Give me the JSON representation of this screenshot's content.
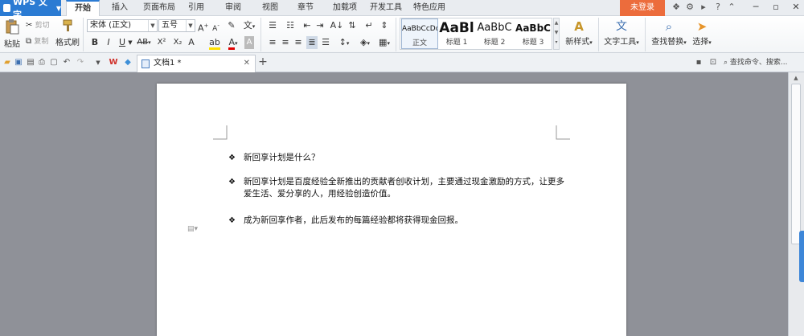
{
  "app": {
    "menu_button": "WPS 文字",
    "login": "未登录"
  },
  "menu": {
    "tabs": [
      "开始",
      "插入",
      "页面布局",
      "引用",
      "审阅",
      "视图",
      "章节",
      "加载项",
      "开发工具",
      "特色应用"
    ],
    "active_tab": "开始"
  },
  "ribbon": {
    "paste": "粘贴",
    "cut": "剪切",
    "copy": "复制",
    "format_painter": "格式刷",
    "font_name": "宋体 (正文)",
    "font_size": "五号",
    "bold": "B",
    "italic": "I",
    "underline": "U",
    "superscript": "X²",
    "subscript": "X₂",
    "styles": [
      {
        "preview": "AaBbCcDd",
        "name": "正文"
      },
      {
        "preview": "AaBl",
        "name": "标题 1"
      },
      {
        "preview": "AaBbC",
        "name": "标题 2"
      },
      {
        "preview": "AaBbC",
        "name": "标题 3"
      }
    ],
    "new_style": "新样式",
    "text_tools": "文字工具",
    "find_replace": "查找替换",
    "select": "选择"
  },
  "tabbar": {
    "doc_title": "文档1 *",
    "search_placeholder": "查找命令、搜索..."
  },
  "document": {
    "bullets": [
      "新回享计划是什么？",
      "新回享计划是百度经验全新推出的贡献者创收计划，主要通过现金激励的方式，让更多爱生活、爱分享的人，用经验创造价值。",
      "成为新回享作者，此后发布的每篇经验都将获得现金回报。"
    ]
  }
}
